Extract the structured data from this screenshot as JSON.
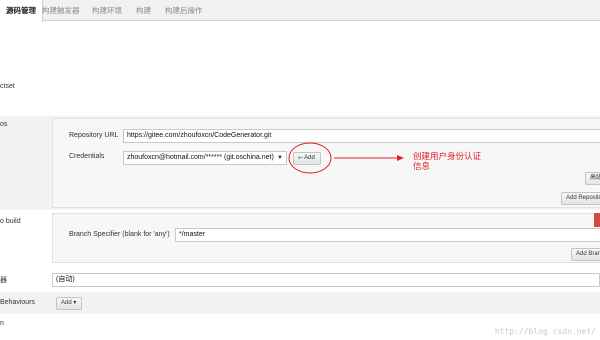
{
  "tabs": [
    {
      "label": "源码管理",
      "active": true
    },
    {
      "label": "构建触发器",
      "active": false
    },
    {
      "label": "构建环境",
      "active": false
    },
    {
      "label": "构建",
      "active": false
    },
    {
      "label": "构建后操作",
      "active": false
    }
  ],
  "left_labels": {
    "subset": "ctset",
    "repos": "os",
    "to_build": "o build",
    "browser": "器",
    "behaviours": "Behaviours",
    "bottom": "n"
  },
  "repository": {
    "url_label": "Repository URL",
    "url_value": "https://gitee.com/zhoufoxcn/CodeGenerator.git",
    "credentials_label": "Credentials",
    "credentials_value": "zhoufoxcn@hotmail.com/****** (git.oschina.net)",
    "add_button": "Add",
    "advanced_button": "高级",
    "add_repository_button": "Add Repository"
  },
  "branch": {
    "label": "Branch Specifier (blank for 'any')",
    "value": "*/master",
    "add_branch_button": "Add Branch"
  },
  "browser_select": {
    "value": "(自动)"
  },
  "behaviours": {
    "add_button": "Add"
  },
  "annotation": {
    "line1": "创建用户身份认证",
    "line2": "信息",
    "color": "#e0202a"
  },
  "watermark": "http://blog.csdn.net/"
}
